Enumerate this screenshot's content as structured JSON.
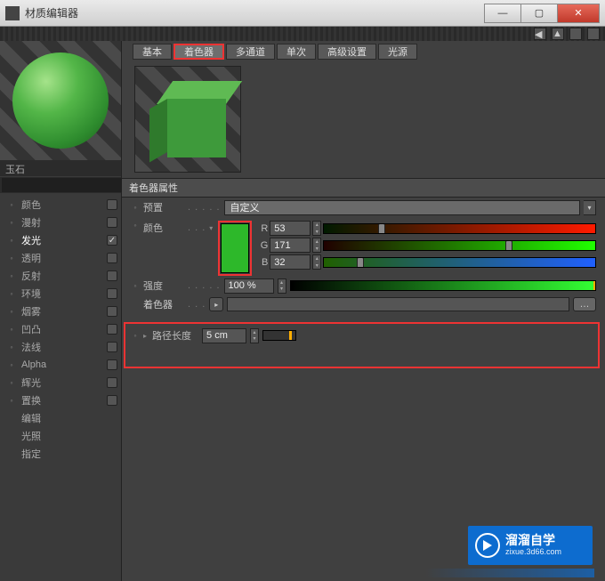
{
  "window": {
    "title": "材质编辑器",
    "min": "—",
    "max": "▢",
    "close": "✕"
  },
  "material_name": "玉石",
  "channels": [
    {
      "label": "颜色",
      "checked": false
    },
    {
      "label": "漫射",
      "checked": false
    },
    {
      "label": "发光",
      "checked": true
    },
    {
      "label": "透明",
      "checked": false
    },
    {
      "label": "反射",
      "checked": false
    },
    {
      "label": "环境",
      "checked": false
    },
    {
      "label": "烟雾",
      "checked": false
    },
    {
      "label": "凹凸",
      "checked": false
    },
    {
      "label": "法线",
      "checked": false
    },
    {
      "label": "Alpha",
      "checked": false
    },
    {
      "label": "辉光",
      "checked": false
    },
    {
      "label": "置换",
      "checked": false
    }
  ],
  "sub_items": [
    "编辑",
    "光照",
    "指定"
  ],
  "tabs": [
    "基本",
    "着色器",
    "多通道",
    "单次",
    "高级设置",
    "光源"
  ],
  "active_tab": 1,
  "section_header": "着色器属性",
  "props": {
    "preset_label": "预置",
    "preset_value": "自定义",
    "color_label": "颜色",
    "rgb": {
      "R": "53",
      "G": "171",
      "B": "32"
    },
    "strength_label": "强度",
    "strength_value": "100 %",
    "shader_label": "着色器",
    "path_label": "路径长度",
    "path_value": "5 cm"
  },
  "watermark": {
    "line1": "溜溜自学",
    "line2": "zixue.3d66.com"
  }
}
